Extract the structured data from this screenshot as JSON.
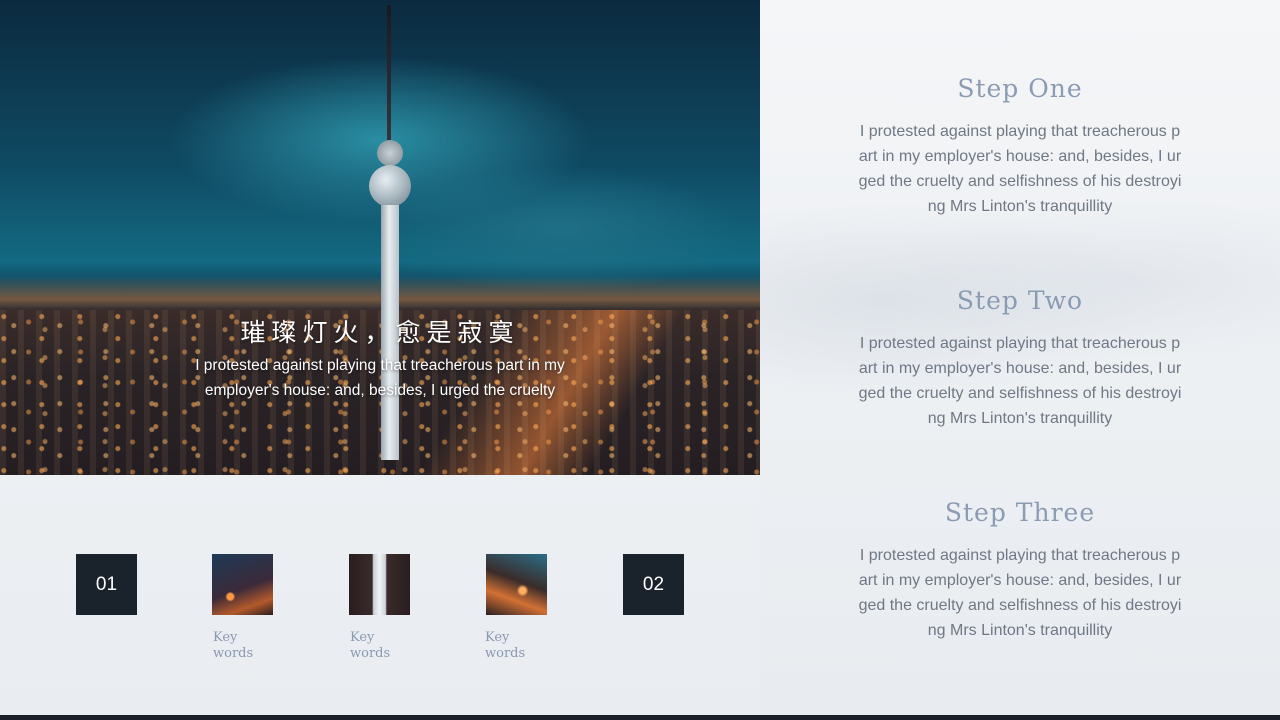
{
  "hero": {
    "title": "璀璨灯火，愈是寂寞",
    "description": "I protested against playing that treacherous part in my employer's house: and, besides, I urged the cruelty"
  },
  "thumbnails": [
    {
      "type": "number",
      "label": "01"
    },
    {
      "type": "image",
      "caption": "Key words"
    },
    {
      "type": "image",
      "caption": "Key words"
    },
    {
      "type": "image",
      "caption": "Key words"
    },
    {
      "type": "number",
      "label": "02"
    }
  ],
  "steps": [
    {
      "title": "Step One",
      "body": "I protested against playing that treacherous part in my employer's house: and, besides, I urged the cruelty and selfishness of his destroying Mrs Linton's tranquillity"
    },
    {
      "title": "Step Two",
      "body": "I protested against playing that treacherous part in my employer's house: and, besides, I urged the cruelty and selfishness of his destroying Mrs Linton's tranquillity"
    },
    {
      "title": "Step Three",
      "body": "I protested against playing that treacherous part in my employer's house: and, besides, I urged the cruelty and selfishness of his destroying Mrs Linton's tranquillity"
    }
  ],
  "colors": {
    "accent_title": "#8b9bb2",
    "dark_tile": "#1a222c",
    "body_text": "#6f7884"
  }
}
